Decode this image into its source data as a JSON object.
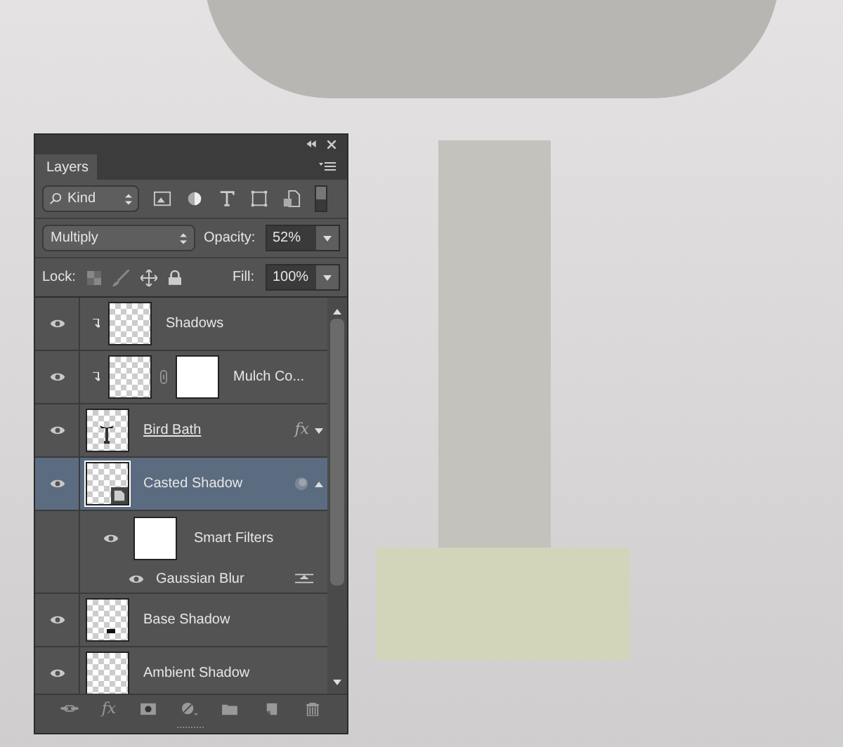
{
  "panel": {
    "tab": {
      "label": "Layers",
      "selected": true
    },
    "filter": {
      "value": "Kind"
    },
    "blend": {
      "value": "Multiply",
      "opacity_label": "Opacity:",
      "opacity": "52%"
    },
    "lock": {
      "label": "Lock:",
      "fill_label": "Fill:",
      "fill": "100%"
    },
    "layers": [
      {
        "kind": "layer",
        "name": "Shadows",
        "visible": true,
        "selected": false,
        "clipped": true
      },
      {
        "kind": "layer",
        "name": "Mulch Co...",
        "visible": true,
        "selected": false,
        "clipped": true,
        "mask": true
      },
      {
        "kind": "layer",
        "name": "Bird Bath",
        "visible": true,
        "selected": false,
        "underline": true,
        "fx": "fx",
        "expanded": false,
        "thumbnail_figure": true
      },
      {
        "kind": "smart_object",
        "name": "Casted Shadow",
        "visible": true,
        "selected": true,
        "expanded": true,
        "children": [
          {
            "kind": "smart_filters",
            "name": "Smart Filters",
            "visible": true,
            "children": [
              {
                "kind": "filter",
                "name": "Gaussian Blur",
                "visible": true
              }
            ]
          }
        ]
      },
      {
        "kind": "layer",
        "name": "Base Shadow",
        "visible": true,
        "selected": false,
        "thumbnail_speck": true
      },
      {
        "kind": "layer",
        "name": "Ambient Shadow",
        "visible": true,
        "selected": false
      }
    ],
    "toolbar": [
      {
        "kind": "link"
      },
      {
        "kind": "fx",
        "label": "fx"
      },
      {
        "kind": "mask"
      },
      {
        "kind": "adjust"
      },
      {
        "kind": "group"
      },
      {
        "kind": "new"
      },
      {
        "kind": "trash"
      }
    ]
  }
}
